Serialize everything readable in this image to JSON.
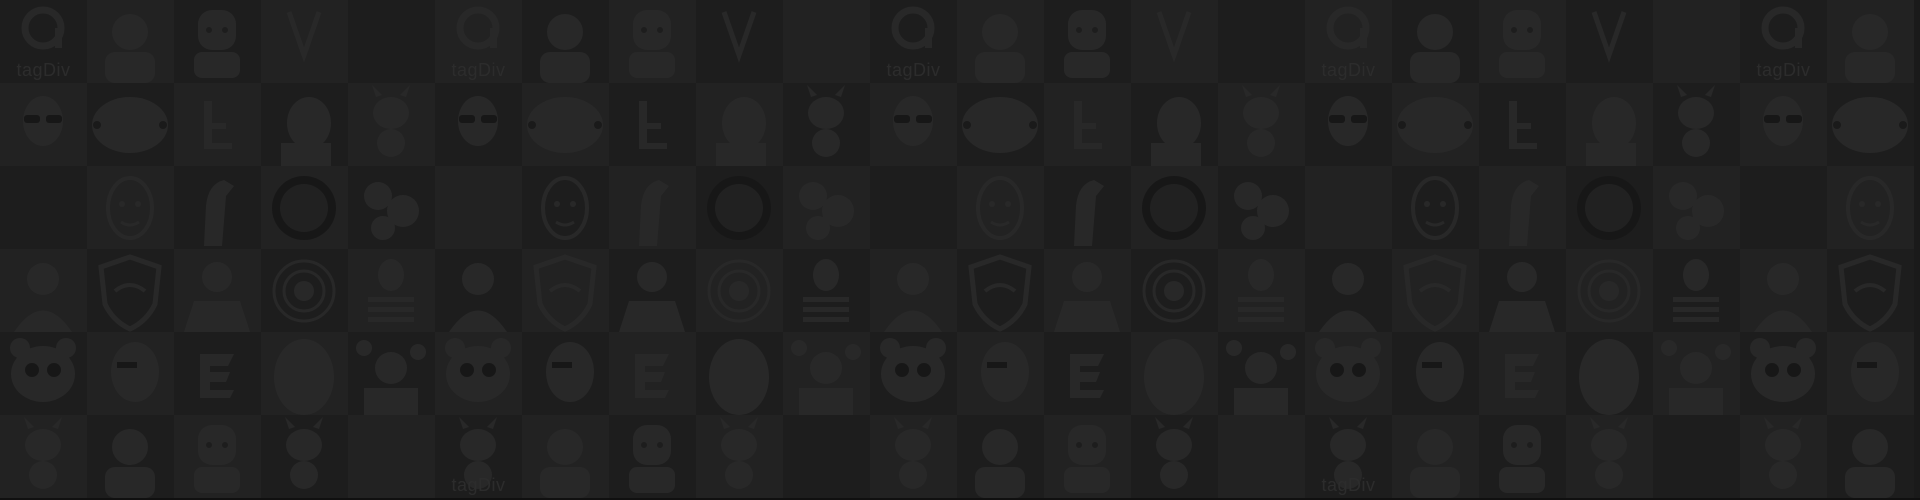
{
  "background": {
    "base_color": "#1e1e1e",
    "tile_dark": "#232323",
    "tile_light": "#2a2a2a",
    "icon_color": "#343434",
    "caption_color": "#3a3a3a"
  },
  "avatar_wall": {
    "columns": 22,
    "rows": 6,
    "caption_text": "tagDiv",
    "rows_pattern": [
      [
        "logo-a",
        "man-photo",
        "cartoon-man",
        "logo-v",
        "blank",
        "logo-a",
        "man-photo",
        "cartoon-man",
        "logo-v",
        "blank",
        "logo-a",
        "man-photo",
        "cartoon-man",
        "logo-v",
        "blank",
        "logo-a",
        "man-photo",
        "cartoon-man",
        "logo-v",
        "blank",
        "logo-a",
        "man-photo"
      ],
      [
        "sunglasses-man",
        "oval-badge",
        "letter-t",
        "laughing-man",
        "zebra-cartoon",
        "sunglasses-man",
        "oval-badge",
        "letter-t",
        "laughing-man",
        "zebra-cartoon",
        "sunglasses-man",
        "oval-badge",
        "letter-t",
        "laughing-man",
        "zebra-cartoon",
        "sunglasses-man",
        "oval-badge",
        "letter-t",
        "laughing-man",
        "zebra-cartoon",
        "sunglasses-man",
        "oval-badge"
      ],
      [
        "blank",
        "cartoon-face",
        "horse",
        "round-photo",
        "floral",
        "blank",
        "cartoon-face",
        "horse",
        "round-photo",
        "floral",
        "blank",
        "cartoon-face",
        "horse",
        "round-photo",
        "floral",
        "blank",
        "cartoon-face",
        "horse",
        "round-photo",
        "floral",
        "blank",
        "cartoon-face"
      ],
      [
        "woman-photo",
        "shield-logo",
        "suit-man",
        "mandala",
        "striped-woman",
        "woman-photo",
        "shield-logo",
        "suit-man",
        "mandala",
        "striped-woman",
        "woman-photo",
        "shield-logo",
        "suit-man",
        "mandala",
        "striped-woman",
        "woman-photo",
        "shield-logo",
        "suit-man",
        "mandala",
        "striped-woman",
        "woman-photo",
        "shield-logo"
      ],
      [
        "panda-cartoon",
        "man-eyepatch",
        "letter-e-logo",
        "face-closeup",
        "floral-man",
        "panda-cartoon",
        "man-eyepatch",
        "letter-e-logo",
        "face-closeup",
        "floral-man",
        "panda-cartoon",
        "man-eyepatch",
        "letter-e-logo",
        "face-closeup",
        "floral-man",
        "panda-cartoon",
        "man-eyepatch",
        "letter-e-logo",
        "face-closeup",
        "floral-man",
        "panda-cartoon",
        "man-eyepatch"
      ],
      [
        "zebra-cartoon",
        "man-photo",
        "cartoon-man",
        "zebra-cartoon",
        "blank",
        "zebra-cartoon",
        "man-photo",
        "cartoon-man",
        "zebra-cartoon",
        "blank",
        "zebra-cartoon",
        "man-photo",
        "cartoon-man",
        "zebra-cartoon",
        "blank",
        "zebra-cartoon",
        "man-photo",
        "cartoon-man",
        "zebra-cartoon",
        "blank",
        "zebra-cartoon",
        "man-photo"
      ]
    ],
    "captioned_tiles": [
      [
        0,
        0
      ],
      [
        0,
        5
      ],
      [
        0,
        10
      ],
      [
        0,
        15
      ],
      [
        0,
        20
      ],
      [
        5,
        5
      ],
      [
        5,
        15
      ]
    ]
  }
}
